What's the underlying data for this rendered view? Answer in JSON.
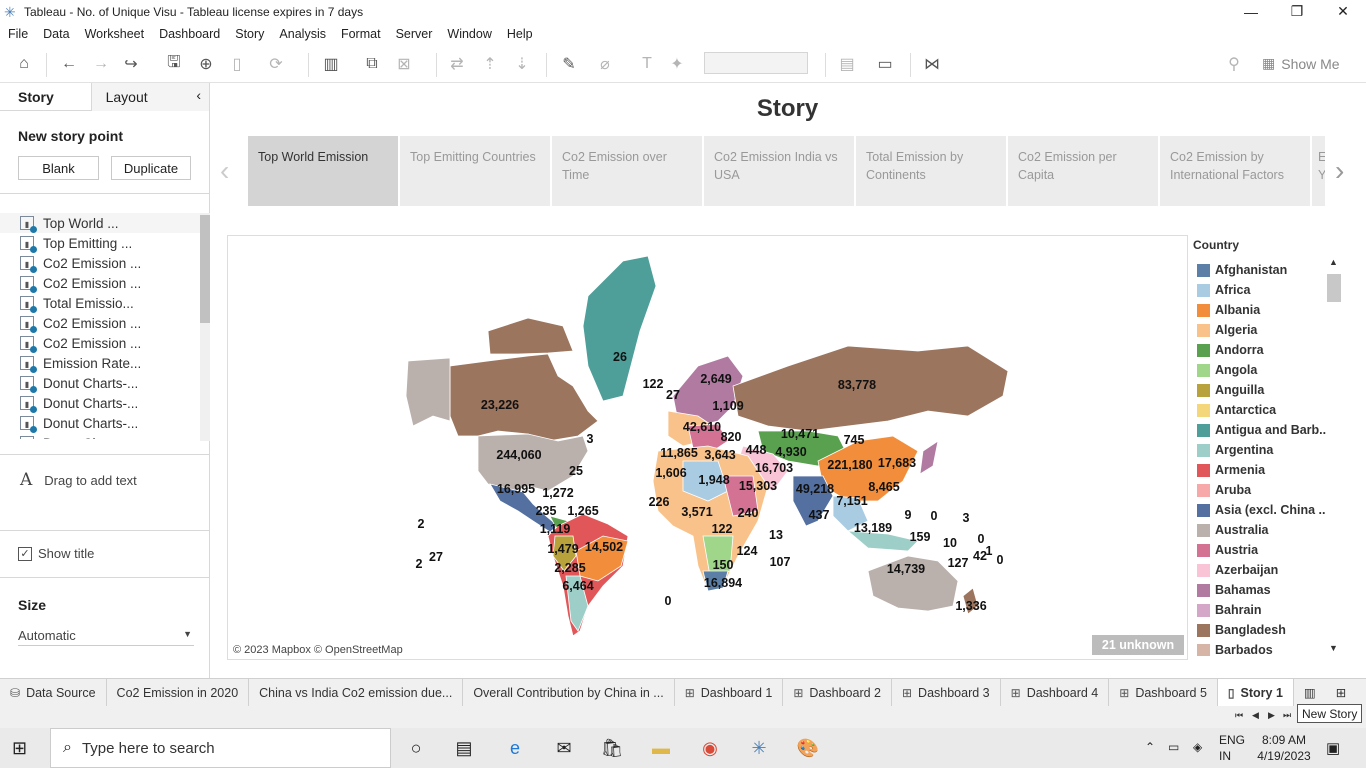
{
  "window": {
    "title": "Tableau - No. of Unique Visu - Tableau license expires in 7 days"
  },
  "menu": [
    "File",
    "Data",
    "Worksheet",
    "Dashboard",
    "Story",
    "Analysis",
    "Format",
    "Server",
    "Window",
    "Help"
  ],
  "toolbar": {
    "show_me": "Show Me"
  },
  "left_pane": {
    "tab_story": "Story",
    "tab_layout": "Layout",
    "new_story_point": "New story point",
    "blank_button": "Blank",
    "duplicate_button": "Duplicate",
    "sheets": [
      "Top World ...",
      "Top Emitting ...",
      "Co2 Emission ...",
      "Co2 Emission ...",
      "Total Emissio...",
      "Co2 Emission ...",
      "Co2 Emission ...",
      "Emission Rate...",
      "Donut Charts-...",
      "Donut Charts-...",
      "Donut Charts-...",
      "Donut Chart..."
    ],
    "drag_text": "Drag to add text",
    "show_title": "Show title",
    "size_label": "Size",
    "size_value": "Automatic"
  },
  "story": {
    "title": "Story",
    "points": [
      "Top World Emission",
      "Top Emitting Countries",
      "Co2 Emission over Time",
      "Co2 Emission India vs USA",
      "Total Emission by Continents",
      "Co2 Emission per Capita",
      "Co2 Emission by International Factors",
      "E Y"
    ]
  },
  "map": {
    "attribution": "© 2023 Mapbox © OpenStreetMap",
    "unknown_badge": "21 unknown",
    "labels": [
      "26",
      "23,226",
      "244,060",
      "3",
      "25",
      "16,995",
      "1,272",
      "235",
      "1,265",
      "1,119",
      "1,479",
      "14,502",
      "2,285",
      "6,464",
      "2",
      "27",
      "2",
      "0",
      "122",
      "27",
      "2,649",
      "1,109",
      "42,610",
      "820",
      "11,865",
      "3,643",
      "1,606",
      "1,948",
      "15,303",
      "226",
      "3,571",
      "240",
      "122",
      "13",
      "124",
      "150",
      "107",
      "16,894",
      "83,778",
      "10,471",
      "745",
      "448",
      "4,930",
      "16,703",
      "221,180",
      "17,683",
      "49,218",
      "8,465",
      "437",
      "7,151",
      "13,189",
      "159",
      "9",
      "0",
      "3",
      "10",
      "0",
      "1",
      "0",
      "42",
      "127",
      "14,739",
      "1,336"
    ]
  },
  "legend": {
    "title": "Country",
    "items": [
      {
        "name": "Afghanistan",
        "color": "#5b7fa6"
      },
      {
        "name": "Africa",
        "color": "#a9cce3"
      },
      {
        "name": "Albania",
        "color": "#f28e3b"
      },
      {
        "name": "Algeria",
        "color": "#f8c28a"
      },
      {
        "name": "Andorra",
        "color": "#59a14f"
      },
      {
        "name": "Angola",
        "color": "#9fd68a"
      },
      {
        "name": "Anguilla",
        "color": "#b8a23c"
      },
      {
        "name": "Antarctica",
        "color": "#f5d77b"
      },
      {
        "name": "Antigua and Barb..",
        "color": "#4e9f9a"
      },
      {
        "name": "Argentina",
        "color": "#9dcfc8"
      },
      {
        "name": "Armenia",
        "color": "#e15759"
      },
      {
        "name": "Aruba",
        "color": "#f7a8a8"
      },
      {
        "name": "Asia (excl. China ..",
        "color": "#5470a0"
      },
      {
        "name": "Australia",
        "color": "#bab0ac"
      },
      {
        "name": "Austria",
        "color": "#d47294"
      },
      {
        "name": "Azerbaijan",
        "color": "#f9c5d6"
      },
      {
        "name": "Bahamas",
        "color": "#b07aa1"
      },
      {
        "name": "Bahrain",
        "color": "#d4a6c8"
      },
      {
        "name": "Bangladesh",
        "color": "#9c755f"
      },
      {
        "name": "Barbados",
        "color": "#d7b5a6"
      }
    ]
  },
  "sheet_tabs": [
    "Data Source",
    "Co2 Emission in 2020",
    "China vs India Co2 emission due...",
    "Overall Contribution by China in ...",
    "Dashboard 1",
    "Dashboard 2",
    "Dashboard 3",
    "Dashboard 4",
    "Dashboard 5",
    "Story 1"
  ],
  "tooltip": "New Story",
  "taskbar": {
    "search_placeholder": "Type here to search",
    "lang_top": "ENG",
    "lang_bottom": "IN",
    "time": "8:09 AM",
    "date": "4/19/2023"
  }
}
